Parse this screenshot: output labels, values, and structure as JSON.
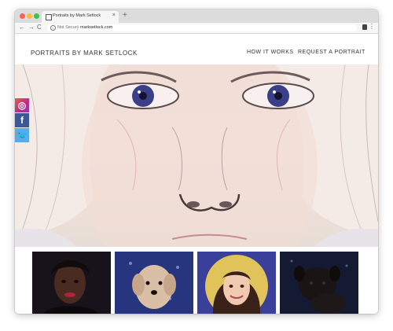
{
  "browser": {
    "tab_title": "Portraits by Mark Setlock",
    "tab_close": "×",
    "new_tab": "+",
    "back": "←",
    "forward": "→",
    "reload": "C",
    "security_label": "Not Secure",
    "url": "marksetlock.com",
    "menu": "⋮"
  },
  "site": {
    "brand": "PORTRAITS BY MARK SETLOCK",
    "nav": [
      "HOW IT WORKS",
      "REQUEST A PORTRAIT"
    ]
  },
  "social": [
    {
      "name": "instagram-icon",
      "glyph": "◎"
    },
    {
      "name": "facebook-icon",
      "glyph": "f"
    },
    {
      "name": "twitter-icon",
      "glyph": "🐦"
    }
  ],
  "colors": {
    "instagram": "#bc2a8d",
    "facebook": "#3b5998",
    "twitter": "#55acee",
    "eye": "#3a3f88"
  }
}
